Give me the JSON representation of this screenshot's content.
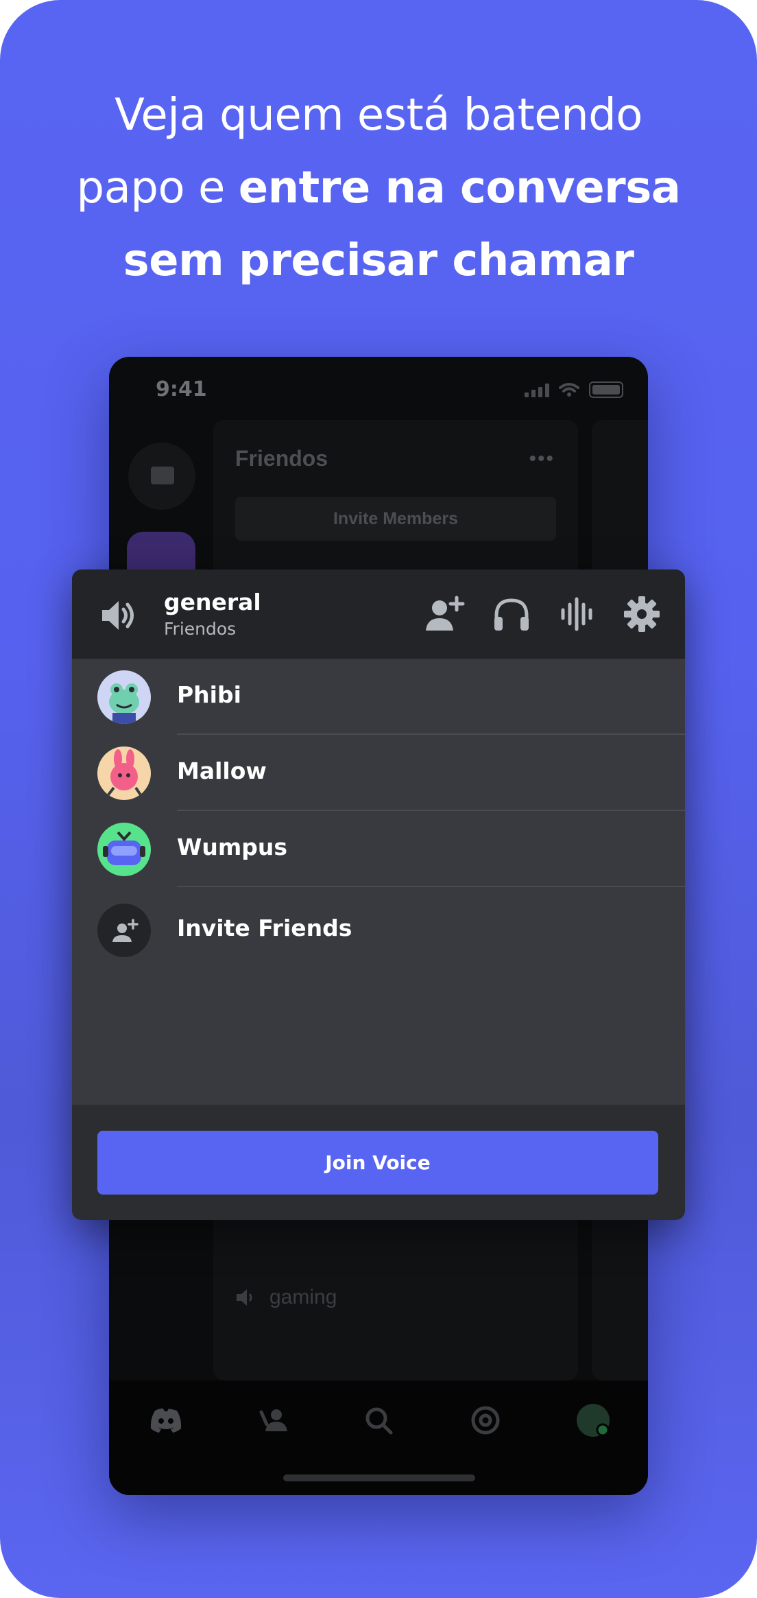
{
  "headline": {
    "line1": "Veja quem está batendo",
    "line2_normal": "papo e ",
    "line2_bold": "entre na conversa",
    "line3_bold": "sem precisar chamar"
  },
  "phone": {
    "time": "9:41",
    "server_name": "Friendos",
    "invite_members_label": "Invite Members",
    "background_channel": "gaming"
  },
  "voice_popup": {
    "channel_name": "general",
    "server_name": "Friendos",
    "header_icons": [
      "speaker-icon",
      "add-user-icon",
      "headphones-icon",
      "voice-activity-icon",
      "gear-icon"
    ],
    "members": [
      {
        "name": "Phibi"
      },
      {
        "name": "Mallow"
      },
      {
        "name": "Wumpus"
      }
    ],
    "invite_friends_label": "Invite Friends",
    "join_voice_label": "Join Voice"
  },
  "colors": {
    "background": "#5865f2",
    "blurple": "#5865f2",
    "popup_body": "#383a40",
    "popup_header": "#232428"
  }
}
